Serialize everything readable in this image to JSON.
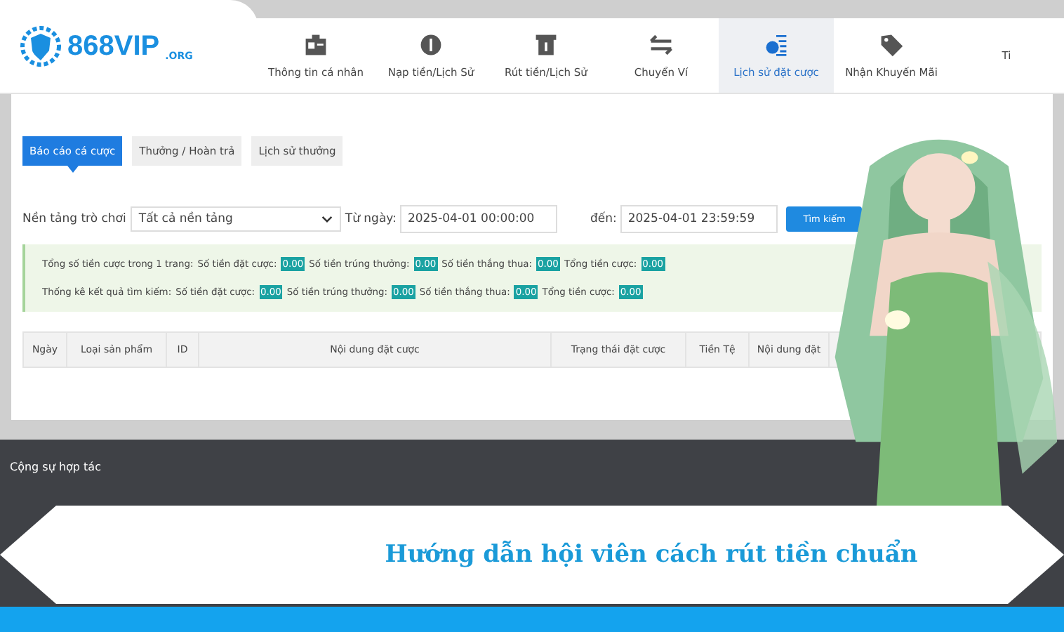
{
  "logo": {
    "name": "868VIP",
    "suffix": ".ORG"
  },
  "nav": [
    {
      "label": "Thông tin cá nhân",
      "selected": false
    },
    {
      "label": "Nạp tiền/Lịch Sử",
      "selected": false
    },
    {
      "label": "Rút tiền/Lịch Sử",
      "selected": false
    },
    {
      "label": "Chuyển Ví",
      "selected": false
    },
    {
      "label": "Lịch sử đặt cược",
      "selected": true
    },
    {
      "label": "Nhận Khuyến Mãi",
      "selected": false
    },
    {
      "label": "Ti",
      "selected": false
    }
  ],
  "subtabs": [
    {
      "label": "Báo cáo cá cược",
      "selected": true
    },
    {
      "label": "Thưởng / Hoàn trả",
      "selected": false
    },
    {
      "label": "Lịch sử thưởng",
      "selected": false
    }
  ],
  "filters": {
    "platform_label": "Nền tảng trò chơi",
    "platform_value": "Tất cả nền tảng",
    "from_label": "Từ ngày:",
    "from_value": "2025-04-01 00:00:00",
    "to_label": "đến:",
    "to_value": "2025-04-01 23:59:59",
    "search_button": "Tìm kiếm"
  },
  "summary": [
    {
      "lead": "Tổng số tiền cược trong 1 trang:",
      "items": [
        {
          "label": "Số tiền đặt cược:",
          "value": "0.00"
        },
        {
          "label": "Số tiền trúng thưởng:",
          "value": "0.00"
        },
        {
          "label": "Số tiền thắng thua:",
          "value": "0.00"
        },
        {
          "label": "Tổng tiền cược:",
          "value": "0.00"
        }
      ]
    },
    {
      "lead": "Thống kê kết quả tìm kiếm:",
      "items": [
        {
          "label": "Số tiền đặt cược:",
          "value": "0.00"
        },
        {
          "label": "Số tiền trúng thưởng:",
          "value": "0.00"
        },
        {
          "label": "Số tiền thắng thua:",
          "value": "0.00"
        },
        {
          "label": "Tổng tiền cược:",
          "value": "0.00"
        }
      ]
    }
  ],
  "table": {
    "columns": [
      "Ngày",
      "Loại sản phẩm",
      "ID",
      "Nội dung đặt cược",
      "Trạng thái đặt cược",
      "Tiền Tệ",
      "Nội dung đặt"
    ]
  },
  "footer": {
    "partners_title": "Cộng sự hợp tác"
  },
  "banner": {
    "title": "Hướng dẫn hội viên cách rút tiền chuẩn"
  }
}
